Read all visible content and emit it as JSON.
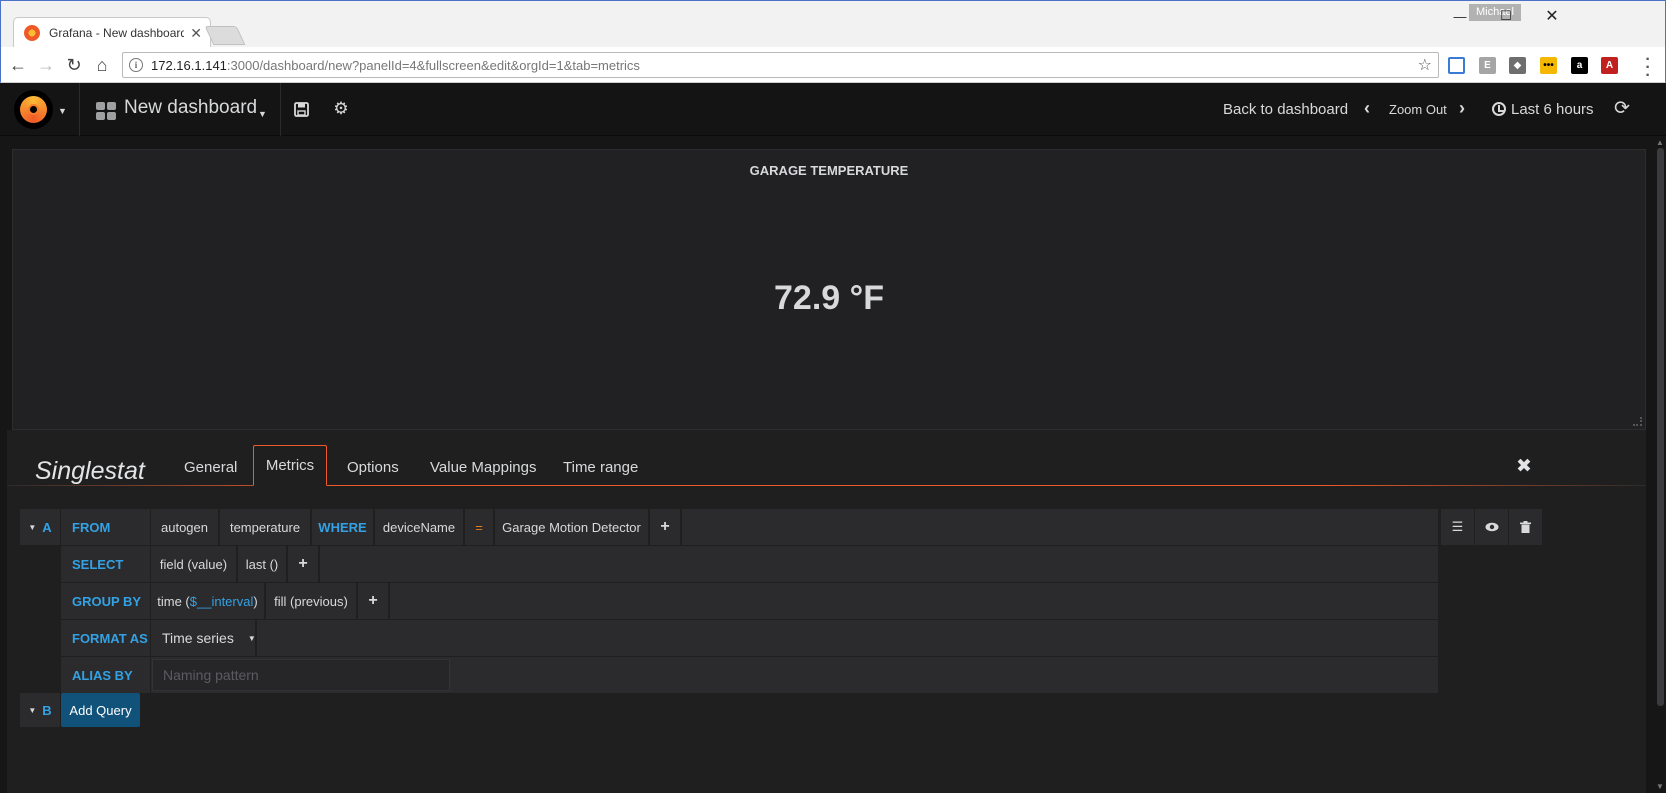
{
  "browser": {
    "tab_title": "Grafana - New dashboard",
    "profile": "Michael",
    "url_host": "172.16.1.141",
    "url_rest": ":3000/dashboard/new?panelId=4&fullscreen&edit&orgId=1&tab=metrics"
  },
  "navbar": {
    "dashboard_title": "New dashboard",
    "back_label": "Back to dashboard",
    "zoom_label": "Zoom Out",
    "time_range": "Last 6 hours"
  },
  "panel": {
    "title": "GARAGE TEMPERATURE",
    "value": "72.9 °F"
  },
  "editor": {
    "panel_type": "Singlestat",
    "tabs": [
      "General",
      "Metrics",
      "Options",
      "Value Mappings",
      "Time range"
    ],
    "active_tab": "Metrics"
  },
  "query_a": {
    "letter": "A",
    "from_kw": "FROM",
    "retention": "autogen",
    "measurement": "temperature",
    "where_kw": "WHERE",
    "tag_key": "deviceName",
    "operator": "=",
    "tag_value": "Garage Motion Detector",
    "select_kw": "SELECT",
    "select_field": "field (value)",
    "select_fn": "last ()",
    "group_kw": "GROUP BY",
    "group_time_prefix": "time (",
    "group_time_var": "$__interval",
    "group_time_suffix": ")",
    "group_fill": "fill (previous)",
    "format_kw": "FORMAT AS",
    "format_value": "Time series",
    "alias_kw": "ALIAS BY",
    "alias_placeholder": "Naming pattern"
  },
  "query_b": {
    "letter": "B",
    "add_label": "Add Query"
  }
}
